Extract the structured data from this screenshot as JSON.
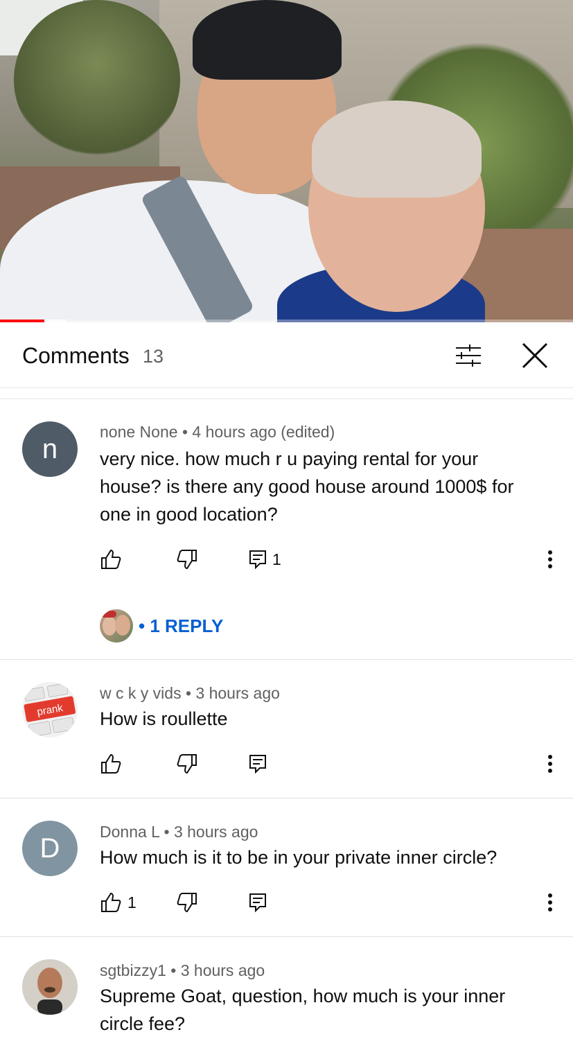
{
  "video": {
    "progress": {
      "played_fraction": 0.077,
      "buffered_fraction": 0.115
    }
  },
  "header": {
    "title": "Comments",
    "count": "13",
    "icons": {
      "filter": "sort-filter-icon",
      "close": "close-icon"
    }
  },
  "colors": {
    "progress_played": "#ff0000",
    "link_blue": "#065fd4",
    "avatar_n": "#4f5b66",
    "avatar_d": "#8194a1"
  },
  "comments": [
    {
      "avatar_letter": "n",
      "author": "none None",
      "time": "4 hours ago (edited)",
      "text": "very nice. how much r u paying rental for your house? is there any good house around 1000$ for one in good location?",
      "likes": "",
      "replies_count": "1",
      "reply_link": "• 1 REPLY"
    },
    {
      "avatar_image": "prank keyboard key",
      "avatar_text": "prank",
      "author": "w c k y vids",
      "time": "3 hours ago",
      "text": "How is roullette",
      "likes": "",
      "replies_count": ""
    },
    {
      "avatar_letter": "D",
      "author": "Donna L",
      "time": "3 hours ago",
      "text": "How much is it to be in your private inner circle?",
      "likes": "1",
      "replies_count": ""
    },
    {
      "avatar_image": "profile photo",
      "author": "sgtbizzy1",
      "time": "3 hours ago",
      "text": "Supreme Goat, question, how much is your inner circle fee?"
    }
  ],
  "separator": "•"
}
